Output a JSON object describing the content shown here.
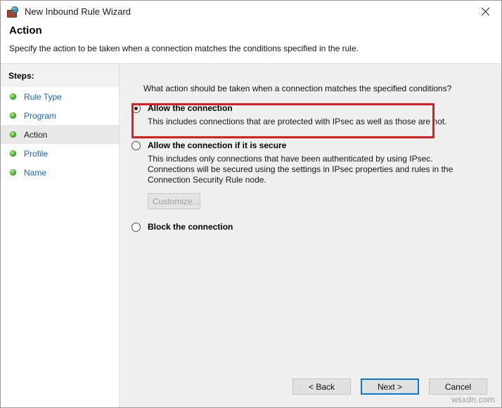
{
  "window": {
    "title": "New Inbound Rule Wizard",
    "icon": "firewall-globe-icon",
    "close_label": "✕"
  },
  "header": {
    "title": "Action",
    "subtitle": "Specify the action to be taken when a connection matches the conditions specified in the rule."
  },
  "sidebar": {
    "heading": "Steps:",
    "items": [
      {
        "label": "Rule Type",
        "current": false
      },
      {
        "label": "Program",
        "current": false
      },
      {
        "label": "Action",
        "current": true
      },
      {
        "label": "Profile",
        "current": false
      },
      {
        "label": "Name",
        "current": false
      }
    ]
  },
  "main": {
    "question": "What action should be taken when a connection matches the specified conditions?",
    "options": [
      {
        "title": "Allow the connection",
        "description": "This includes connections that are protected with IPsec as well as those are not.",
        "selected": true,
        "highlighted": true
      },
      {
        "title": "Allow the connection if it is secure",
        "description": "This includes only connections that have been authenticated by using IPsec.  Connections will be secured using the settings in IPsec properties and rules in the Connection Security Rule node.",
        "selected": false,
        "highlighted": false,
        "button": {
          "label": "Customize...",
          "disabled": true
        }
      },
      {
        "title": "Block the connection",
        "description": "",
        "selected": false,
        "highlighted": false
      }
    ]
  },
  "footer": {
    "buttons": [
      {
        "label": "< Back",
        "default": false
      },
      {
        "label": "Next >",
        "default": true
      },
      {
        "label": "Cancel",
        "default": false
      }
    ],
    "watermark": "wsxdn.com"
  },
  "colors": {
    "highlight_red": "#e01b22",
    "link_blue": "#1665c0",
    "focus_blue": "#0078d7",
    "panel_gray": "#f0f0f0"
  }
}
